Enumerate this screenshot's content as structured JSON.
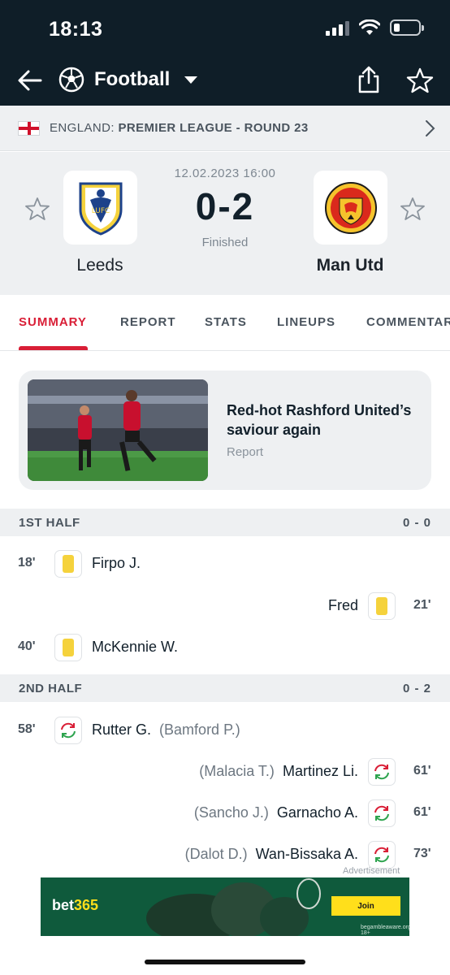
{
  "status_bar": {
    "time": "18:13"
  },
  "nav": {
    "sport_title": "Football",
    "icons": [
      "back-arrow-icon",
      "football-icon",
      "caret-down-icon",
      "share-icon",
      "star-icon"
    ]
  },
  "league": {
    "country": "ENGLAND:",
    "competition": "PREMIER LEAGUE - ROUND 23"
  },
  "match": {
    "date": "12.02.2023 16:00",
    "score": "0-2",
    "status": "Finished",
    "home": {
      "name": "Leeds"
    },
    "away": {
      "name": "Man Utd"
    }
  },
  "tabs": [
    "SUMMARY",
    "REPORT",
    "STATS",
    "LINEUPS",
    "COMMENTARY"
  ],
  "report": {
    "title": "Red-hot Rashford United’s saviour again",
    "tag": "Report"
  },
  "first_half": {
    "title": "1ST HALF",
    "score": "0 - 0",
    "events": [
      {
        "minute": "18'",
        "player": "Firpo J.",
        "side": "home",
        "type": "yellow-card"
      },
      {
        "minute": "21'",
        "player": "Fred",
        "side": "away",
        "type": "yellow-card"
      },
      {
        "minute": "40'",
        "player": "McKennie W.",
        "side": "home",
        "type": "yellow-card"
      }
    ]
  },
  "second_half": {
    "title": "2ND HALF",
    "score": "0 - 2",
    "events": [
      {
        "minute": "58'",
        "player": "Rutter G.",
        "sub": "(Bamford P.)",
        "side": "home",
        "type": "substitution"
      },
      {
        "minute": "61'",
        "player": "Martinez Li.",
        "sub": "(Malacia T.)",
        "side": "away",
        "type": "substitution"
      },
      {
        "minute": "61'",
        "player": "Garnacho A.",
        "sub": "(Sancho J.)",
        "side": "away",
        "type": "substitution"
      },
      {
        "minute": "73'",
        "player": "Wan-Bissaka A.",
        "sub": "(Dalot D.)",
        "side": "away",
        "type": "substitution"
      }
    ]
  },
  "ad": {
    "label": "Advertisement",
    "brand_a": "bet",
    "brand_b": "365",
    "cta": "Join",
    "disclaimer": "begambleaware.org  18+"
  },
  "colors": {
    "header_bg": "#0f1e28",
    "accent": "#d91e36",
    "yellow_card": "#f5d23c",
    "panel_bg": "#eef0f2"
  }
}
